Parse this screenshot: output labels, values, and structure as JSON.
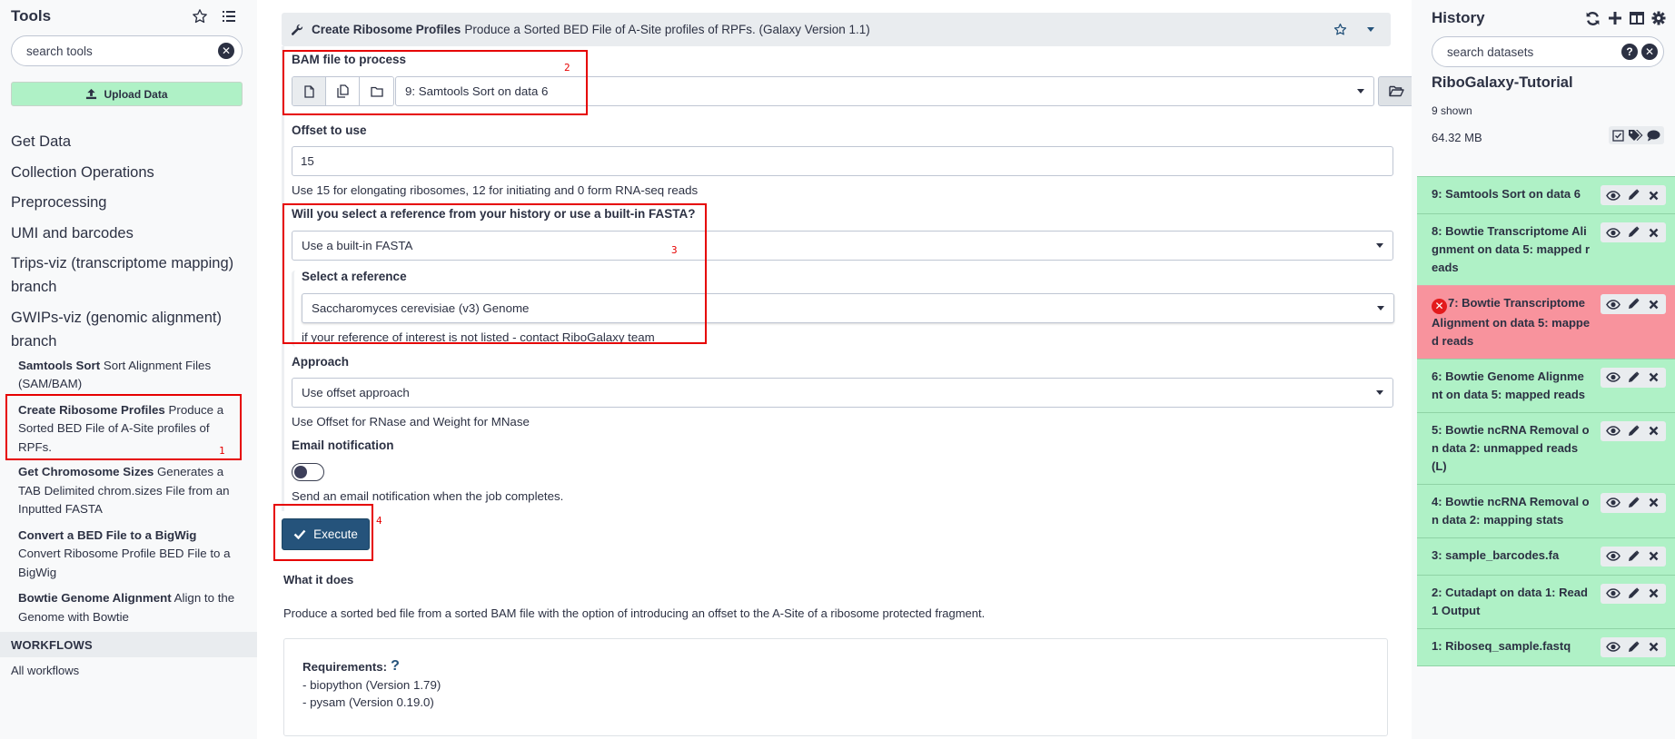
{
  "tool_panel": {
    "title": "Tools",
    "search_placeholder": "search tools",
    "upload_label": "Upload Data",
    "sections": [
      "Get Data",
      "Collection Operations",
      "Preprocessing",
      "UMI and barcodes",
      "Trips-viz (transcriptome mapping) branch",
      "GWIPs-viz (genomic alignment) branch"
    ],
    "tools": [
      {
        "name": "Samtools Sort",
        "desc": "Sort Alignment Files (SAM/BAM)"
      },
      {
        "name": "Create Ribosome Profiles",
        "desc": "Produce a Sorted BED File of A-Site profiles of RPFs."
      },
      {
        "name": "Get Chromosome Sizes",
        "desc": "Generates a TAB Delimited chrom.sizes File from an Inputted FASTA"
      },
      {
        "name": "Convert a BED File to a BigWig",
        "desc": "Convert Ribosome Profile BED File to a BigWig"
      },
      {
        "name": "Bowtie Genome Alignment",
        "desc": "Align to the Genome with Bowtie"
      }
    ],
    "workflows_header": "WORKFLOWS",
    "workflows_link": "All workflows"
  },
  "tool_form": {
    "tool_name": "Create Ribosome Profiles",
    "tool_desc": "Produce a Sorted BED File of A-Site profiles of RPFs. (Galaxy Version 1.1)",
    "bam_label": "BAM file to process",
    "bam_value": "9: Samtools Sort on data 6",
    "offset_label": "Offset to use",
    "offset_value": "15",
    "offset_help": "Use 15 for elongating ribosomes, 12 for initiating and 0 form RNA-seq reads",
    "ref_question": "Will you select a reference from your history or use a built-in FASTA?",
    "ref_source_value": "Use a built-in FASTA",
    "select_ref_label": "Select a reference",
    "select_ref_value": "Saccharomyces cerevisiae (v3) Genome",
    "select_ref_help": "if your reference of interest is not listed - contact RiboGalaxy team",
    "approach_label": "Approach",
    "approach_value": "Use offset approach",
    "approach_help": "Use Offset for RNase and Weight for MNase",
    "email_label": "Email notification",
    "email_enabled": false,
    "email_help": "Send an email notification when the job completes.",
    "execute_label": "Execute",
    "what_it_does_title": "What it does",
    "what_it_does_text": "Produce a sorted bed file from a sorted BAM file with the option of introducing an offset to the A-Site of a ribosome protected fragment.",
    "requirements_title": "Requirements:",
    "requirements_help": "?",
    "requirements": [
      "- biopython (Version 1.79)",
      "- pysam (Version 0.19.0)"
    ]
  },
  "annotations": [
    "1",
    "2",
    "3",
    "4"
  ],
  "history": {
    "title": "History",
    "search_placeholder": "search datasets",
    "name": "RiboGalaxy-Tutorial",
    "shown": "9 shown",
    "size": "64.32 MB",
    "datasets": [
      {
        "title": "9: Samtools Sort on data 6",
        "state": "ok"
      },
      {
        "title": "8: Bowtie Transcriptome Alignment on data 5: mapped reads",
        "state": "ok"
      },
      {
        "title": "7: Bowtie Transcriptome Alignment on data 5: mapped reads",
        "state": "error"
      },
      {
        "title": "6: Bowtie Genome Alignment on data 5: mapped reads",
        "state": "ok"
      },
      {
        "title": "5: Bowtie ncRNA Removal on data 2: unmapped reads (L)",
        "state": "ok"
      },
      {
        "title": "4: Bowtie ncRNA Removal on data 2: mapping stats",
        "state": "ok"
      },
      {
        "title": "3: sample_barcodes.fa",
        "state": "ok"
      },
      {
        "title": "2: Cutadapt on data 1: Read 1 Output",
        "state": "ok"
      },
      {
        "title": "1: Riboseq_sample.fastq",
        "state": "ok"
      }
    ]
  },
  "colors": {
    "ok_state": "#aff1c6",
    "error_state": "#f8939d",
    "primary": "#25537b",
    "annotation": "#e60000"
  }
}
